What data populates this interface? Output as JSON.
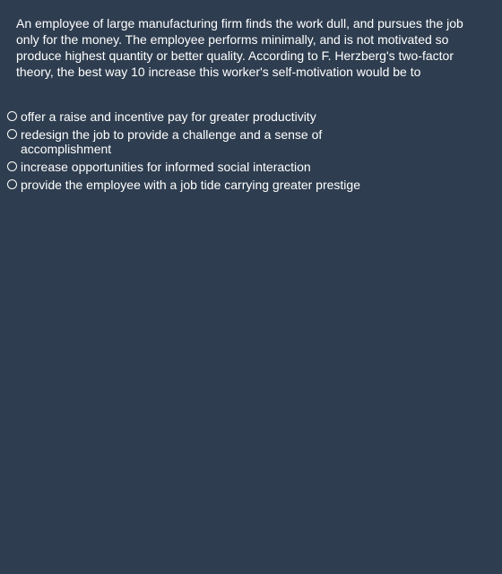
{
  "question": {
    "text": "An employee of large manufacturing firm finds the work dull, and pursues the job only for the money. The employee performs minimally, and is not motivated so produce highest quantity or better quality. According to F. Herzberg's two-factor theory, the best way 10 increase this worker's self-motivation would be to"
  },
  "options": [
    {
      "label": "offer a raise and incentive pay for greater productivity",
      "selected": false
    },
    {
      "label": "redesign the job to provide a challenge and a sense of accomplishment",
      "selected": false
    },
    {
      "label": "increase opportunities for informed social interaction",
      "selected": false
    },
    {
      "label": "provide the employee with a job tide carrying greater prestige",
      "selected": false
    }
  ],
  "colors": {
    "background": "#2e3d4f",
    "text": "#ffffff"
  }
}
